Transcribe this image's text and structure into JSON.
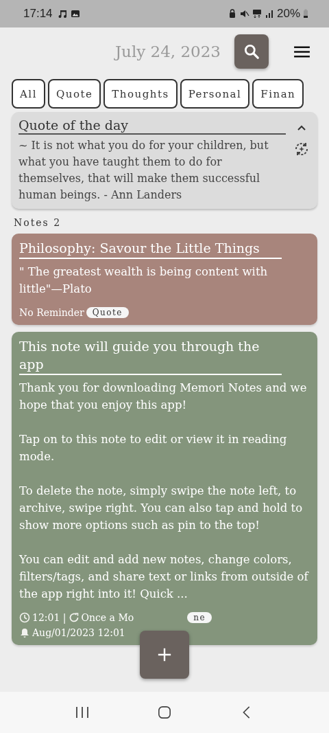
{
  "status_bar": {
    "time": "17:14",
    "battery": "20%"
  },
  "header": {
    "date": "July 24, 2023"
  },
  "tabs": [
    {
      "label": "All"
    },
    {
      "label": "Quote"
    },
    {
      "label": "Thoughts"
    },
    {
      "label": "Personal"
    },
    {
      "label": "Finan"
    }
  ],
  "quote_card": {
    "title": "Quote of the day",
    "text": "~ It is not what you do for your children, but what you have taught them to do for themselves, that will make them successful human beings. - Ann Landers",
    "expanded": true
  },
  "notes_label": "Notes 2",
  "notes": [
    {
      "title": "Philosophy: Savour the Little Things",
      "color": "#a8857c",
      "body": [
        "\" The greatest wealth is being content with little\"—Plato"
      ],
      "footer": [
        {
          "kind": "text",
          "text": "No Reminder"
        },
        {
          "kind": "tag",
          "text": "Quote"
        }
      ]
    },
    {
      "title": "This note will guide you through the app",
      "color": "#84957c",
      "body": [
        "Thank you for downloading Memori Notes and we hope that you enjoy this app!",
        "Tap on to this note to edit or view it in reading mode.",
        "To delete the note, simply swipe the note left, to archive, swipe right. You can also tap and hold to show more options such as pin to the top!",
        "You can edit and add new notes, change colors, filters/tags, and share text or links from outside of the app right into it! Quick ..."
      ],
      "footer": [
        {
          "kind": "clock",
          "text": "12:01 |"
        },
        {
          "kind": "repeat",
          "text": "Once a Mo"
        },
        {
          "kind": "gap"
        },
        {
          "kind": "tag",
          "text": "ne"
        },
        {
          "kind": "break"
        },
        {
          "kind": "alarm",
          "text": "Aug/01/2023 12:01"
        }
      ]
    }
  ]
}
